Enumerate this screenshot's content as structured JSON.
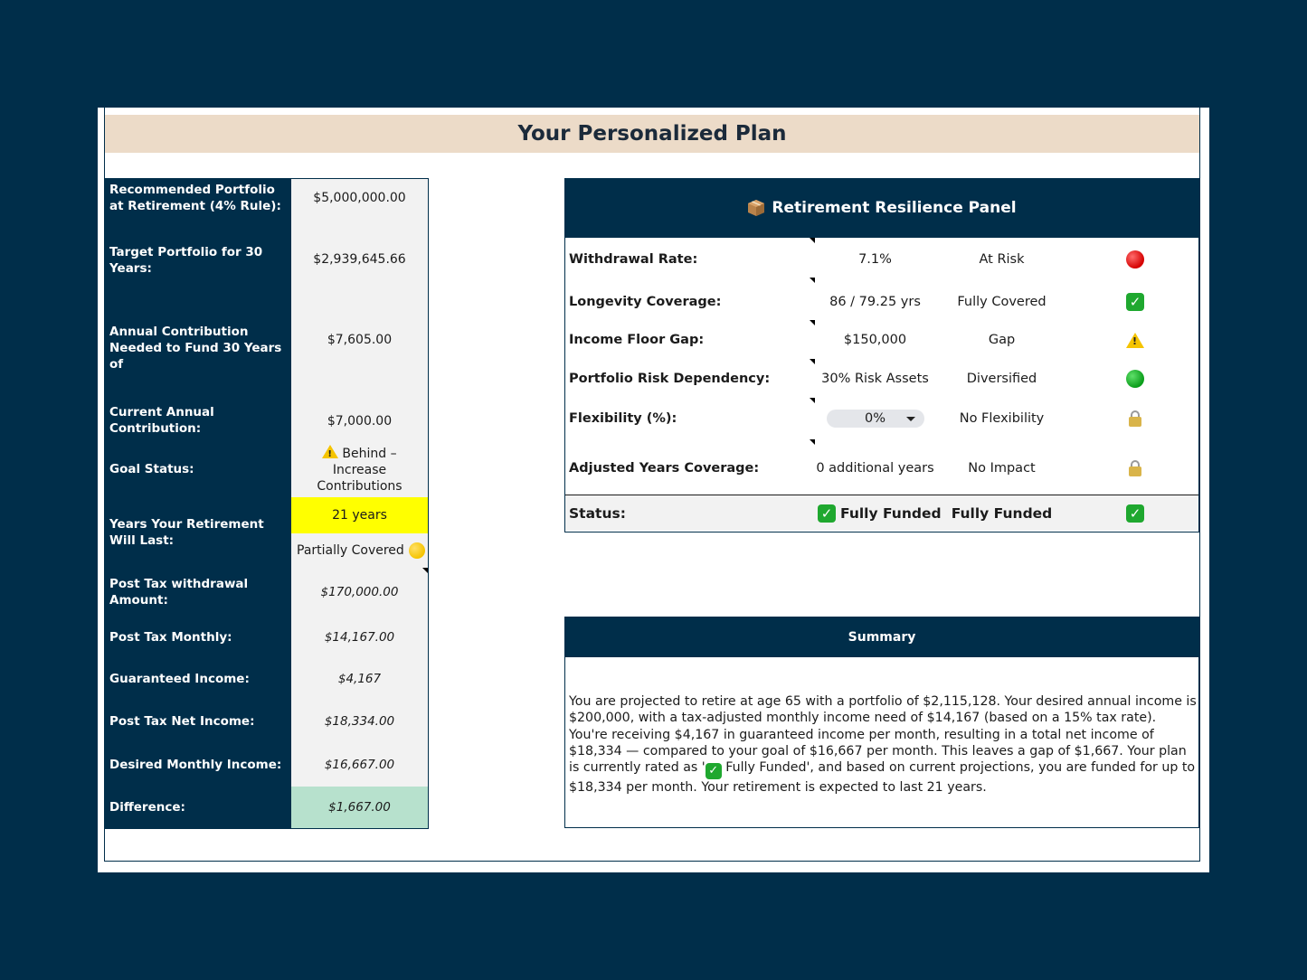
{
  "title": "Your Personalized Plan",
  "left_table": [
    {
      "label": "Recommended Portfolio at Retirement (4% Rule):",
      "value": "$5,000,000.00"
    },
    {
      "label": "Target Portfolio for 30 Years:",
      "value": "$2,939,645.66"
    },
    {
      "label": "Annual Contribution Needed to Fund 30 Years of",
      "value": "$7,605.00"
    },
    {
      "label": "Current Annual Contribution:",
      "value": "$7,000.00"
    },
    {
      "label": "Goal Status:",
      "value": "Behind – Increase Contributions",
      "icon": "warning-icon"
    },
    {
      "label": "Years Your Retirement Will Last:",
      "value": "21 years",
      "value2": "Partially Covered",
      "value2_icon": "yellow-circle-icon"
    },
    {
      "label": "Post Tax withdrawal Amount:",
      "value": "$170,000.00"
    },
    {
      "label": "Post Tax Monthly:",
      "value": "$14,167.00"
    },
    {
      "label": "Guaranteed Income:",
      "value": "$4,167"
    },
    {
      "label": "Post Tax Net Income:",
      "value": "$18,334.00"
    },
    {
      "label": "Desired Monthly Income:",
      "value": "$16,667.00"
    },
    {
      "label": "Difference:",
      "value": "$1,667.00"
    }
  ],
  "panel": {
    "title": "Retirement Resilience Panel",
    "title_icon": "package-icon",
    "rows": [
      {
        "label": "Withdrawal Rate:",
        "value": "7.1%",
        "status": "At Risk",
        "icon": "red-circle-icon"
      },
      {
        "label": "Longevity Coverage:",
        "value": "86 / 79.25 yrs",
        "status": "Fully Covered",
        "icon": "green-check-icon"
      },
      {
        "label": "Income Floor Gap:",
        "value": "$150,000",
        "status": "Gap",
        "icon": "warning-icon"
      },
      {
        "label": "Portfolio Risk Dependency:",
        "value": "30% Risk Assets",
        "status": "Diversified",
        "icon": "green-circle-icon"
      },
      {
        "label": "Flexibility (%):",
        "value": "0%",
        "status": "No Flexibility",
        "icon": "lock-icon"
      },
      {
        "label": "Adjusted Years Coverage:",
        "value": "0 additional years",
        "status": "No Impact",
        "icon": "lock-icon"
      }
    ],
    "status": {
      "label": "Status:",
      "value": "Fully Funded",
      "status": "Fully Funded",
      "icon": "green-check-icon"
    }
  },
  "summary": {
    "title": "Summary",
    "text_before": "You are projected to retire at age 65 with a portfolio of $2,115,128. Your desired annual income is $200,000, with a tax-adjusted monthly income need of $14,167 (based on a 15% tax rate). You're receiving $4,167 in guaranteed income per month, resulting in a total net income of $18,334 — compared to your goal of $16,667 per month. This leaves a gap of $1,667. Your plan is currently rated as '",
    "text_after": " Fully Funded', and based on current projections, you are funded for up to $18,334 per month. Your retirement is expected to last 21 years."
  },
  "colors": {
    "navy": "#002e4a",
    "title_bg": "#ecdbc8",
    "highlight_yellow": "#ffff00",
    "highlight_green": "#b7e1cd"
  }
}
